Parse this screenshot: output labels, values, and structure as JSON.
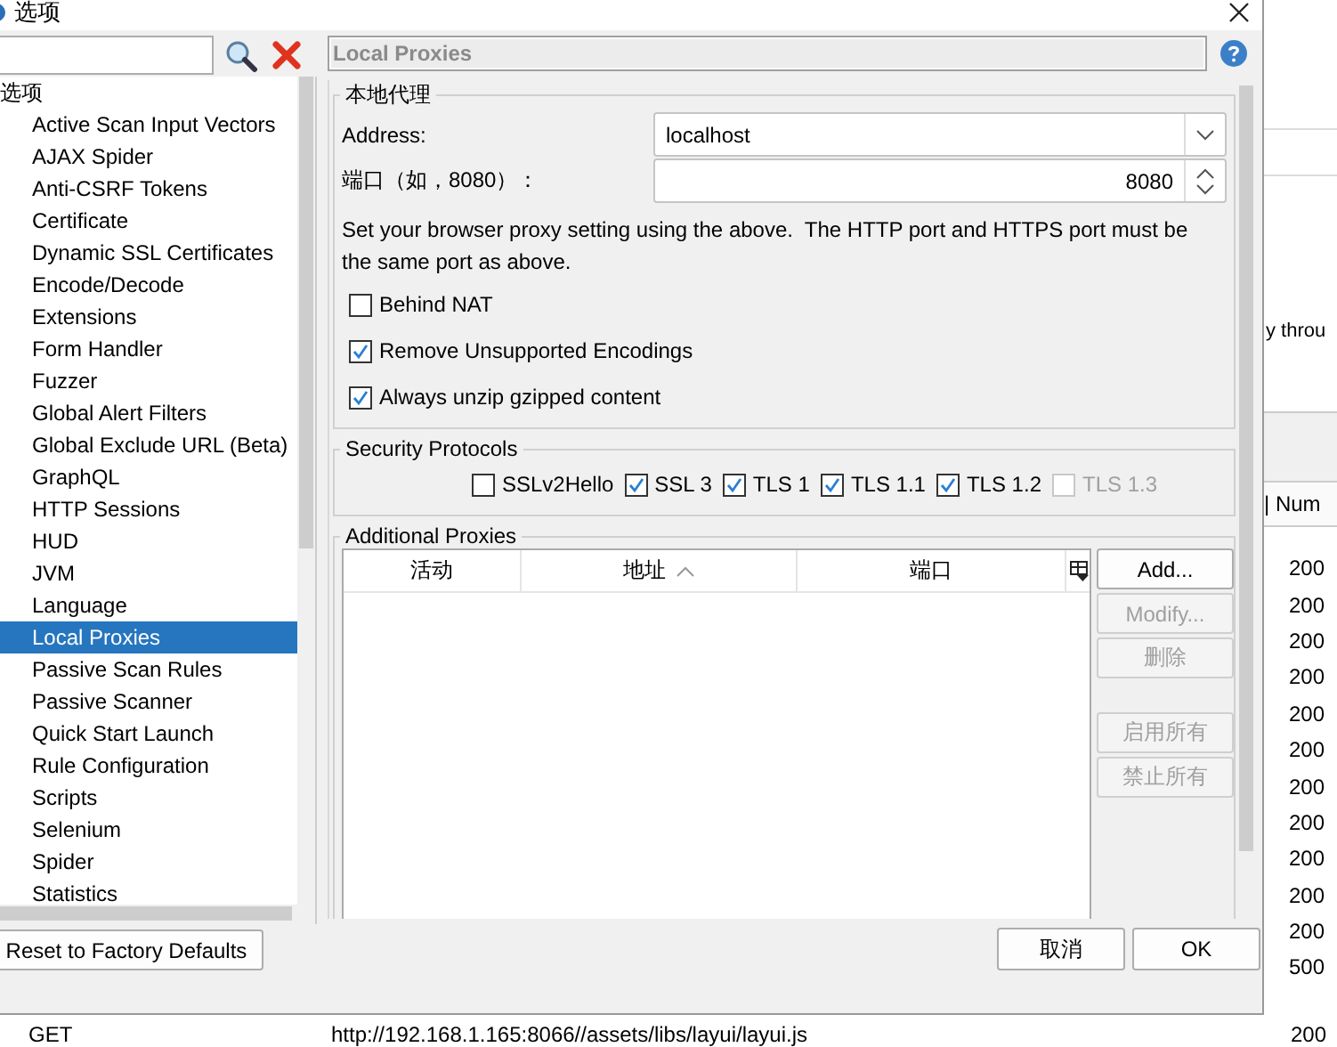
{
  "background": {
    "text_fragment": "y throu",
    "column_header": "| Num",
    "statuses": [
      "200",
      "200",
      "200",
      "200",
      "200",
      "200",
      "200",
      "200",
      "200",
      "200",
      "200",
      "500"
    ],
    "last_row": {
      "method": "GET",
      "url": "http://192.168.1.165:8066//assets/libs/layui/layui.js",
      "status": "200"
    }
  },
  "dialog": {
    "title": "选项",
    "tree": {
      "root": "选项",
      "items": [
        {
          "label": "Active Scan Input Vectors",
          "selected": false
        },
        {
          "label": "AJAX Spider",
          "selected": false
        },
        {
          "label": "Anti-CSRF Tokens",
          "selected": false
        },
        {
          "label": "Certificate",
          "selected": false
        },
        {
          "label": "Dynamic SSL Certificates",
          "selected": false
        },
        {
          "label": "Encode/Decode",
          "selected": false
        },
        {
          "label": "Extensions",
          "selected": false
        },
        {
          "label": "Form Handler",
          "selected": false
        },
        {
          "label": "Fuzzer",
          "selected": false
        },
        {
          "label": "Global Alert Filters",
          "selected": false
        },
        {
          "label": "Global Exclude URL (Beta)",
          "selected": false
        },
        {
          "label": "GraphQL",
          "selected": false
        },
        {
          "label": "HTTP Sessions",
          "selected": false
        },
        {
          "label": "HUD",
          "selected": false
        },
        {
          "label": "JVM",
          "selected": false
        },
        {
          "label": "Language",
          "selected": false
        },
        {
          "label": "Local Proxies",
          "selected": true
        },
        {
          "label": "Passive Scan Rules",
          "selected": false
        },
        {
          "label": "Passive Scanner",
          "selected": false
        },
        {
          "label": "Quick Start Launch",
          "selected": false
        },
        {
          "label": "Rule Configuration",
          "selected": false
        },
        {
          "label": "Scripts",
          "selected": false
        },
        {
          "label": "Selenium",
          "selected": false
        },
        {
          "label": "Spider",
          "selected": false
        },
        {
          "label": "Statistics",
          "selected": false
        }
      ]
    },
    "reset_button": "Reset to Factory Defaults",
    "panel_title": "Local Proxies",
    "local_proxy": {
      "title": "本地代理",
      "address_label": "Address:",
      "address_value": "localhost",
      "port_label": "端口（如，8080）：",
      "port_value": "8080",
      "note": "Set your browser proxy setting using the above.  The HTTP port and HTTPS port must be the same port as above.",
      "options": [
        {
          "label": "Behind NAT",
          "checked": false
        },
        {
          "label": "Remove Unsupported Encodings",
          "checked": true
        },
        {
          "label": "Always unzip gzipped content",
          "checked": true
        }
      ]
    },
    "security_protocols": {
      "title": "Security Protocols",
      "protocols": [
        {
          "label": "SSLv2Hello",
          "checked": false,
          "disabled": false
        },
        {
          "label": "SSL 3",
          "checked": true,
          "disabled": false
        },
        {
          "label": "TLS 1",
          "checked": true,
          "disabled": false
        },
        {
          "label": "TLS 1.1",
          "checked": true,
          "disabled": false
        },
        {
          "label": "TLS 1.2",
          "checked": true,
          "disabled": false
        },
        {
          "label": "TLS 1.3",
          "checked": false,
          "disabled": true
        }
      ]
    },
    "additional_proxies": {
      "title": "Additional Proxies",
      "columns": [
        {
          "label": "活动",
          "sorted": false
        },
        {
          "label": "地址",
          "sorted": true
        },
        {
          "label": "端口",
          "sorted": false
        }
      ],
      "buttons": [
        {
          "label": "Add...",
          "disabled": false
        },
        {
          "label": "Modify...",
          "disabled": true
        },
        {
          "label": "删除",
          "disabled": true
        },
        {
          "label": "启用所有",
          "disabled": true
        },
        {
          "label": "禁止所有",
          "disabled": true
        }
      ]
    },
    "footer_buttons": [
      "取消",
      "OK"
    ]
  }
}
